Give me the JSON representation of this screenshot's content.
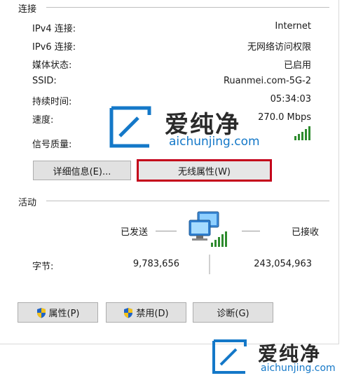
{
  "connection": {
    "title": "连接",
    "rows": [
      {
        "label": "IPv4 连接:",
        "value": "Internet"
      },
      {
        "label": "IPv6 连接:",
        "value": "无网络访问权限"
      },
      {
        "label": "媒体状态:",
        "value": "已启用"
      },
      {
        "label": "SSID:",
        "value": "Ruanmei.com-5G-2"
      },
      {
        "label": "持续时间:",
        "value": "05:34:03"
      },
      {
        "label": "速度:",
        "value": "270.0 Mbps"
      },
      {
        "label": "信号质量:",
        "value": ""
      }
    ],
    "signal_level": 1.0
  },
  "buttons_top": {
    "details": "详细信息(E)...",
    "wireless": "无线属性(W)"
  },
  "activity": {
    "title": "活动",
    "sent_label": "已发送",
    "received_label": "已接收",
    "bytes_label": "字节:",
    "sent_value": "9,783,656",
    "received_value": "243,054,963"
  },
  "buttons_bottom": {
    "properties": "属性(P)",
    "disable": "禁用(D)",
    "diagnose": "诊断(G)"
  },
  "watermark": {
    "brand": "爱纯净",
    "url": "aichunjing.com"
  },
  "colors": {
    "highlight": "#c4001a",
    "signal": "#2e8b2e",
    "watermark": "#1478c8"
  },
  "icons": [
    "network-computers-icon",
    "shield-icon",
    "signal-bars-icon",
    "watermark-logo-icon"
  ]
}
